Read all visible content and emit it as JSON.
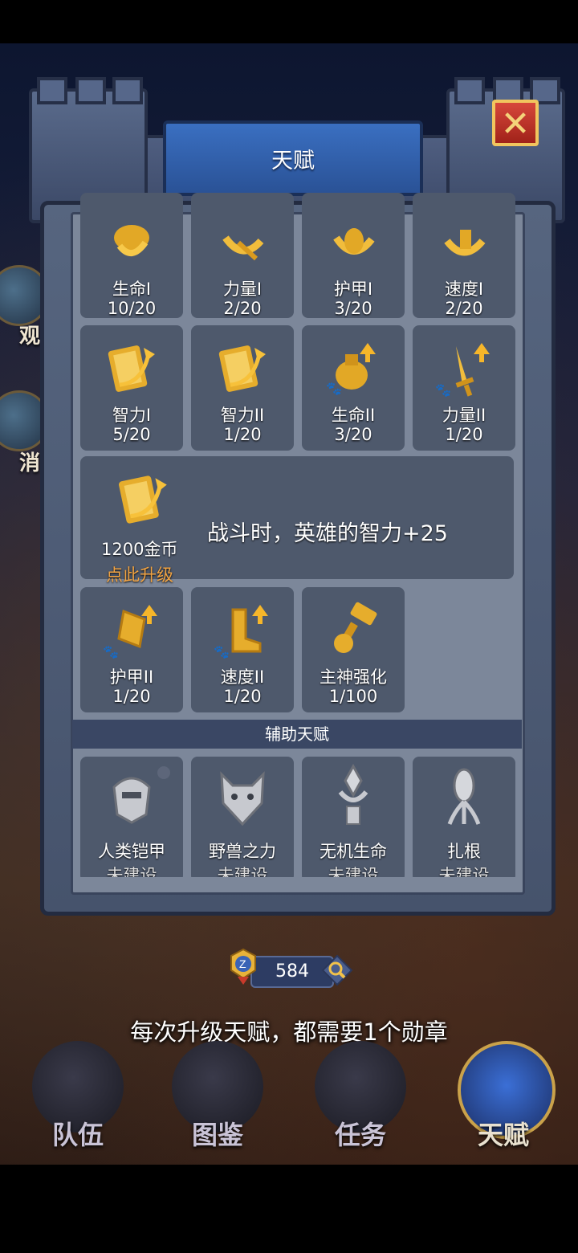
{
  "window": {
    "title": "天赋"
  },
  "side_labels": {
    "left1": "观",
    "left2": "消"
  },
  "talents": [
    {
      "name": "生命I",
      "level": "10/20",
      "icon": "potion-icon"
    },
    {
      "name": "力量I",
      "level": "2/20",
      "icon": "sword-icon"
    },
    {
      "name": "护甲I",
      "level": "3/20",
      "icon": "shield-icon"
    },
    {
      "name": "速度I",
      "level": "2/20",
      "icon": "boot-icon"
    },
    {
      "name": "智力I",
      "level": "5/20",
      "icon": "book-icon"
    },
    {
      "name": "智力II",
      "level": "1/20",
      "icon": "book-icon"
    },
    {
      "name": "生命II",
      "level": "3/20",
      "icon": "potion-icon"
    },
    {
      "name": "力量II",
      "level": "1/20",
      "icon": "sword-icon"
    }
  ],
  "selected": {
    "cost": "1200金币",
    "upgrade_label": "点此升级",
    "description": "战斗时，英雄的智力+25",
    "icon": "book-icon"
  },
  "talents2": [
    {
      "name": "护甲II",
      "level": "1/20",
      "icon": "shield-icon"
    },
    {
      "name": "速度II",
      "level": "1/20",
      "icon": "boot-icon"
    },
    {
      "name": "主神强化",
      "level": "1/100",
      "icon": "hammer-icon"
    }
  ],
  "aux_section": {
    "title": "辅助天赋"
  },
  "aux_talents": [
    {
      "name": "人类铠甲",
      "status": "未建设",
      "icon": "helmet-icon"
    },
    {
      "name": "野兽之力",
      "status": "未建设",
      "icon": "beast-head-icon"
    },
    {
      "name": "无机生命",
      "status": "未建设",
      "icon": "crystal-claw-icon"
    },
    {
      "name": "扎根",
      "status": "未建设",
      "icon": "root-icon"
    }
  ],
  "currency": {
    "medals": "584"
  },
  "hint": "每次升级天赋，都需要1个勋章",
  "nav": [
    {
      "label": "队伍",
      "icon": "knight-helmet-icon"
    },
    {
      "label": "图鉴",
      "icon": "codex-book-icon"
    },
    {
      "label": "任务",
      "icon": "scroll-icon"
    },
    {
      "label": "天赋",
      "icon": "talent-crest-icon"
    }
  ],
  "colors": {
    "gold": "#f6b62a",
    "upgrade": "#f2a443",
    "banner": "#2a5296",
    "cell": "#4e596c"
  }
}
